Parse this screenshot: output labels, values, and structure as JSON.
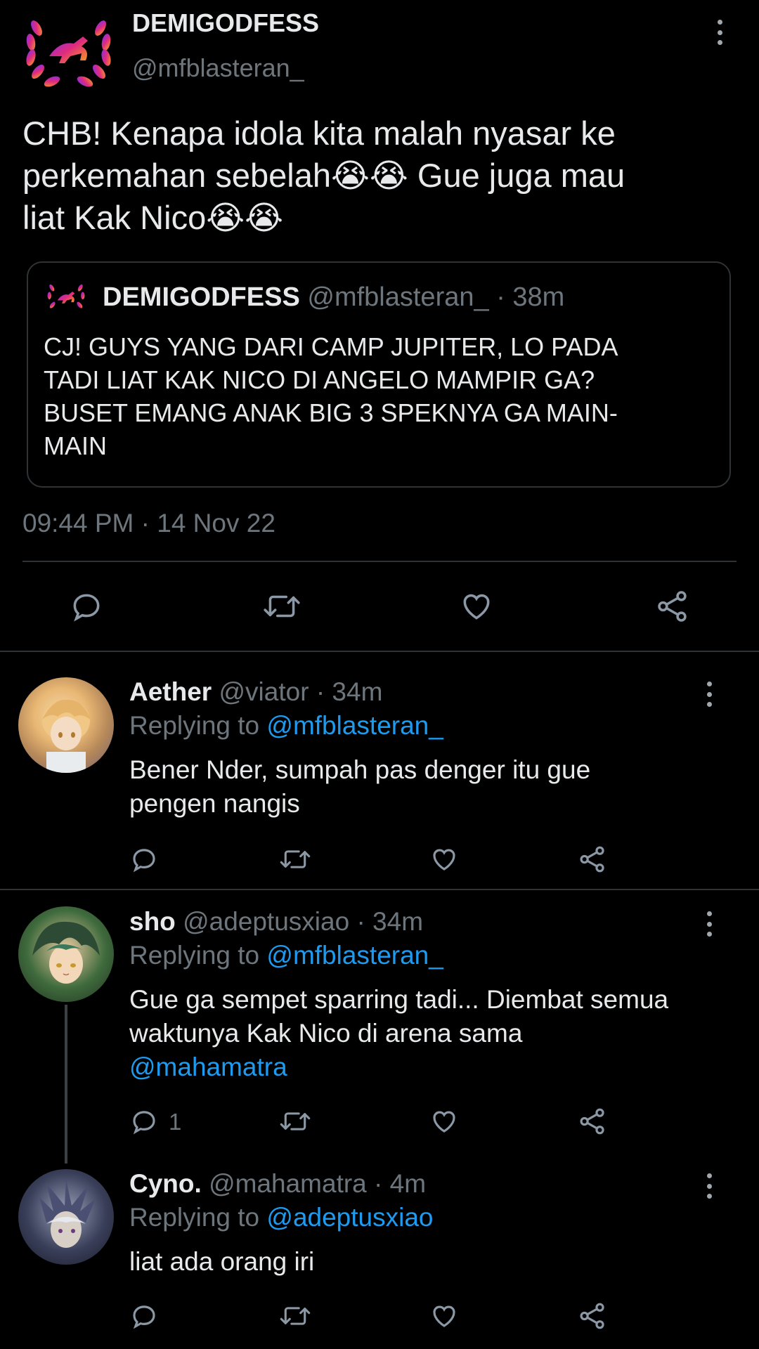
{
  "main_tweet": {
    "display_name": "DEMIGODFESS",
    "handle": "@mfblasteran_",
    "text_lines": [
      "CHB! Kenapa idola kita malah nyasar ke",
      "perkemahan sebelah",
      " Gue juga mau",
      "liat Kak Nico"
    ],
    "emoji": "😭😭",
    "quoted": {
      "display_name": "DEMIGODFESS",
      "handle": "@mfblasteran_",
      "time": "· 38m",
      "text_lines": [
        "CJ! GUYS YANG DARI CAMP JUPITER, LO PADA",
        "TADI LIAT KAK NICO DI ANGELO MAMPIR GA?",
        "BUSET EMANG ANAK BIG 3 SPEKNYA GA MAIN-",
        "MAIN"
      ]
    },
    "timestamp": "09:44 PM · 14 Nov 22"
  },
  "replies": [
    {
      "display_name": "Aether",
      "handle": "@viator",
      "time": "· 34m",
      "replying_prefix": "Replying to",
      "replying_to": "@mfblasteran_",
      "text_lines": [
        "Bener Nder, sumpah pas denger itu gue",
        "pengen nangis"
      ],
      "reply_count": ""
    },
    {
      "display_name": "sho",
      "handle": "@adeptusxiao",
      "time": "· 34m",
      "replying_prefix": "Replying to",
      "replying_to": "@mfblasteran_",
      "text_lines": [
        "Gue ga sempet sparring tadi... Diembat semua",
        "waktunya Kak Nico di arena sama"
      ],
      "mention_line": "@mahamatra",
      "reply_count": "1"
    },
    {
      "display_name": "Cyno.",
      "handle": "@mahamatra",
      "time": "· 4m",
      "replying_prefix": "Replying to",
      "replying_to": "@adeptusxiao",
      "text_lines": [
        "liat ada orang iri"
      ],
      "reply_count": ""
    }
  ],
  "icons": {
    "reply": "reply-icon",
    "retweet": "retweet-icon",
    "like": "like-icon",
    "share": "share-icon",
    "more": "more-vertical-icon"
  },
  "colors": {
    "background": "#000000",
    "text": "#e7e9ea",
    "muted": "#6e767d",
    "link": "#1d9bf0",
    "divider": "#2f3336"
  }
}
